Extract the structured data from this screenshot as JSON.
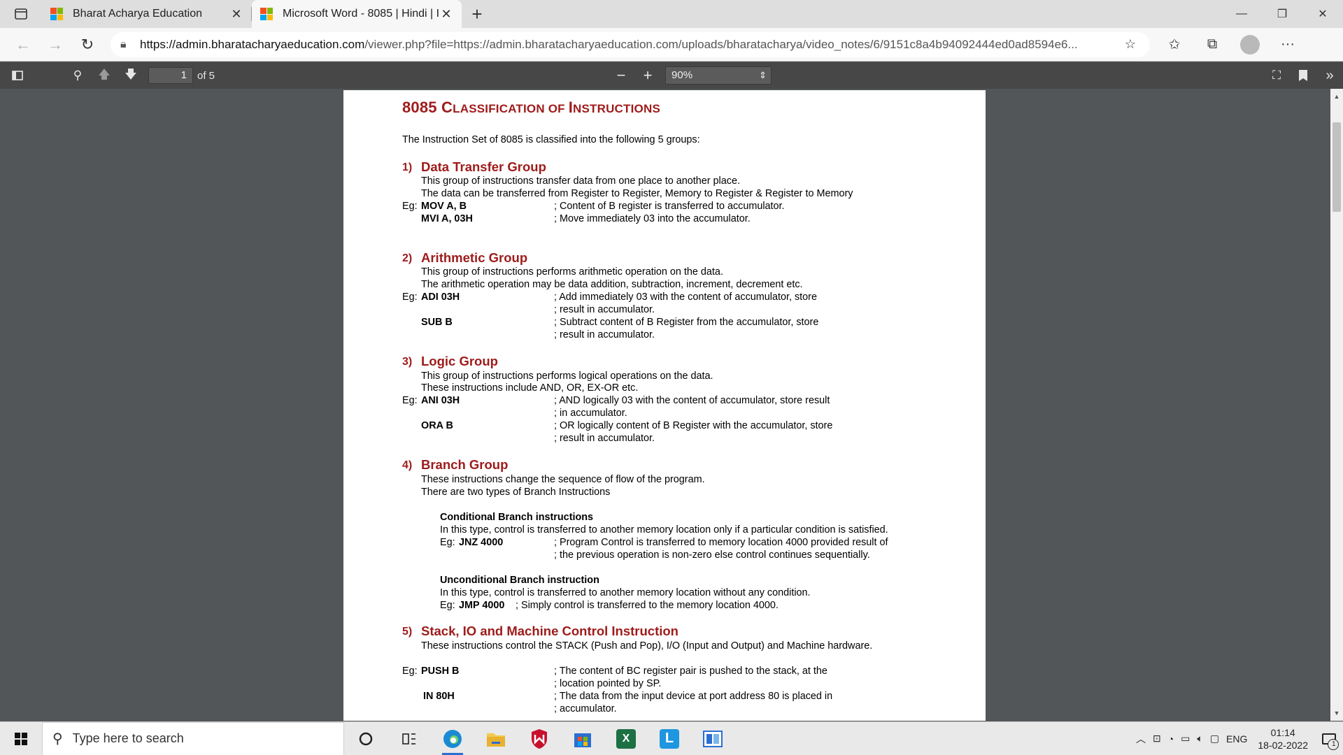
{
  "browser": {
    "tabs": [
      {
        "title": "Bharat Acharya Education",
        "active": false
      },
      {
        "title": "Microsoft Word - 8085 | Hindi | I",
        "active": true
      }
    ],
    "url_host": "https://admin.bharatacharyaeducation.com",
    "url_rest": "/viewer.php?file=https://admin.bharatacharyaeducation.com/uploads/bharatacharya/video_notes/6/9151c8a4b94092444ed0ad8594e6..."
  },
  "pdf_toolbar": {
    "page_number": "1",
    "page_of": "of 5",
    "zoom": "90%"
  },
  "doc": {
    "title_big1": "8085 C",
    "title_small1": "LASSIFICATION OF ",
    "title_big2": "I",
    "title_small2": "NSTRUCTIONS",
    "intro": "The Instruction Set of 8085 is classified into the following 5 groups:",
    "g1_num": "1)",
    "g1_title": "Data Transfer Group",
    "g1_l1": "This group of instructions transfer data from one place to another place.",
    "g1_l2": "The data can be transferred from Register to Register, Memory to Register & Register to Memory",
    "eg": "Eg:",
    "g1_i1": "MOV A, B",
    "g1_c1": "; Content of B register is transferred to accumulator.",
    "g1_i2": "MVI A, 03H",
    "g1_c2": "; Move immediately 03 into the accumulator.",
    "g2_num": "2)",
    "g2_title": "Arithmetic Group",
    "g2_l1": "This group of instructions performs arithmetic operation on the data.",
    "g2_l2": "The arithmetic operation may be data addition, subtraction, increment, decrement etc.",
    "g2_i1": "ADI 03H",
    "g2_c1a": "; Add immediately 03 with the content of accumulator, store",
    "g2_c1b": "; result in accumulator.",
    "g2_i2": "SUB B",
    "g2_c2a": "; Subtract content of B Register from the accumulator, store",
    "g2_c2b": "; result in accumulator.",
    "g3_num": "3)",
    "g3_title": "Logic Group",
    "g3_l1": "This group of instructions performs logical operations on the data.",
    "g3_l2": "These instructions include AND, OR, EX-OR etc.",
    "g3_i1": "ANI 03H",
    "g3_c1a": "; AND logically 03 with the content of accumulator, store result",
    "g3_c1b": "; in accumulator.",
    "g3_i2": "ORA B",
    "g3_c2a": "; OR logically content of B Register with the accumulator, store",
    "g3_c2b": "; result in accumulator.",
    "g4_num": "4)",
    "g4_title": "Branch Group",
    "g4_l1": "These instructions change the sequence of flow of the program.",
    "g4_l2": "There are two types of Branch Instructions",
    "g4_cond_title": "Conditional Branch instructions",
    "g4_cond_l1": "In this type, control is transferred to another memory location only if a particular condition is satisfied.",
    "g4_cond_eg": "Eg:",
    "g4_cond_i": "JNZ 4000",
    "g4_cond_ca": "; Program Control is transferred to memory location 4000 provided result of",
    "g4_cond_cb": "; the previous operation is non-zero else control continues sequentially.",
    "g4_unc_title": "Unconditional Branch instruction",
    "g4_unc_l1": "In this type, control is transferred to another memory location without any condition.",
    "g4_unc_eg": "Eg:",
    "g4_unc_i": "JMP 4000",
    "g4_unc_c": "; Simply control is transferred to the memory location 4000.",
    "g5_num": "5)",
    "g5_title": "Stack, IO and Machine Control Instruction",
    "g5_l1": "These instructions control the STACK (Push and Pop), I/O (Input and Output) and Machine hardware.",
    "g5_i1": "PUSH B",
    "g5_c1a": "; The content of BC register pair is pushed to the stack, at the",
    "g5_c1b": "; location pointed by SP.",
    "g5_i2": "IN 80H",
    "g5_c2a": "; The data from the input device at port address 80 is placed in",
    "g5_c2b": "; accumulator."
  },
  "taskbar": {
    "search_placeholder": "Type here to search",
    "lang": "ENG",
    "time": "01:14",
    "date": "18-02-2022",
    "notifications": "1"
  }
}
